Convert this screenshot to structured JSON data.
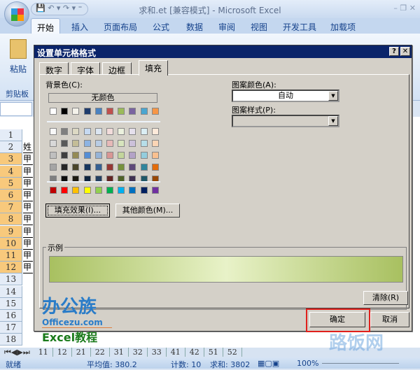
{
  "window": {
    "title": "求和.et [兼容模式] - Microsoft Excel",
    "controls": "–  ❐  ✕"
  },
  "qat": "💾 ↶ ▾ ↷ ▾ ⁼",
  "ribbon_tabs": [
    "开始",
    "插入",
    "页面布局",
    "公式",
    "数据",
    "审阅",
    "视图",
    "开发工具",
    "加载项"
  ],
  "ribbon": {
    "paste": "粘贴",
    "clipboard": "剪贴板"
  },
  "rows": [
    "1",
    "2",
    "3",
    "4",
    "5",
    "6",
    "7",
    "8",
    "9",
    "10",
    "11",
    "12",
    "13",
    "14",
    "15",
    "16",
    "17",
    "18"
  ],
  "selected_rows": [
    "3",
    "4",
    "5",
    "6",
    "7",
    "8",
    "9",
    "10",
    "11",
    "12"
  ],
  "cells": {
    "2": "姓",
    "3": "甲",
    "4": "甲",
    "5": "甲",
    "6": "甲",
    "7": "甲",
    "8": "甲",
    "9": "甲",
    "10": "甲",
    "11": "甲",
    "12": "甲"
  },
  "sheet_tabs": [
    "11",
    "12",
    "21",
    "22",
    "31",
    "32",
    "33",
    "41",
    "42",
    "51",
    "52"
  ],
  "status": {
    "ready": "就绪",
    "average": "平均值: 380.2",
    "count": "计数: 10",
    "sum": "求和: 3802",
    "zoom": "100%"
  },
  "dialog": {
    "title": "设置单元格格式",
    "help": "?",
    "close": "✕",
    "tabs": [
      "数字",
      "字体",
      "边框",
      "填充"
    ],
    "active_tab": "填充",
    "bg_label": "背景色(C):",
    "no_color": "无颜色",
    "palette": [
      [
        "#ffffff",
        "#000000",
        "#f4f2ea",
        "#1f3c6c",
        "#4a82c0",
        "#c0504d",
        "#9bbb59",
        "#7a64a0",
        "#4ba6d0",
        "#f79646"
      ],
      [
        "#f8f8f8",
        "#7f7f7f",
        "#ddd9c4",
        "#c6d9f1",
        "#dbe5f1",
        "#f2dcdb",
        "#ebf1de",
        "#e5e0ec",
        "#dbeef4",
        "#fdeada"
      ],
      [
        "#d8d8d8",
        "#595959",
        "#c4bd97",
        "#8db3e2",
        "#b8cce4",
        "#e6b9b8",
        "#d7e4bd",
        "#ccc1da",
        "#b7dee8",
        "#fbd5b5"
      ],
      [
        "#bfbfbf",
        "#3f3f3f",
        "#948a54",
        "#548dd4",
        "#95b3d7",
        "#d99694",
        "#c3d69b",
        "#b3a2c7",
        "#93cddd",
        "#fac08f"
      ],
      [
        "#a5a5a5",
        "#262626",
        "#4a452a",
        "#17365d",
        "#366092",
        "#953734",
        "#76923c",
        "#5f497a",
        "#31859c",
        "#e36c0a"
      ],
      [
        "#7f7f7f",
        "#0c0c0c",
        "#1d1b11",
        "#0f243e",
        "#244061",
        "#632523",
        "#4f6228",
        "#3f3151",
        "#205867",
        "#974806"
      ],
      [
        "#c00000",
        "#ff0000",
        "#ffc000",
        "#ffff00",
        "#92d050",
        "#00b050",
        "#00b0f0",
        "#0070c0",
        "#002060",
        "#7030a0"
      ]
    ],
    "fill_effects": "填充效果(I)...",
    "more_colors": "其他颜色(M)...",
    "pattern_color_label": "图案颜色(A):",
    "pattern_color": "自动",
    "pattern_style_label": "图案样式(P):",
    "pattern_style": "",
    "sample_label": "示例",
    "clear": "清除(R)",
    "ok": "确定",
    "cancel": "取消"
  },
  "logo": {
    "name": "办公族",
    "site": "Officezu.com",
    "caption": "Excel教程"
  },
  "watermark": "路饭网"
}
